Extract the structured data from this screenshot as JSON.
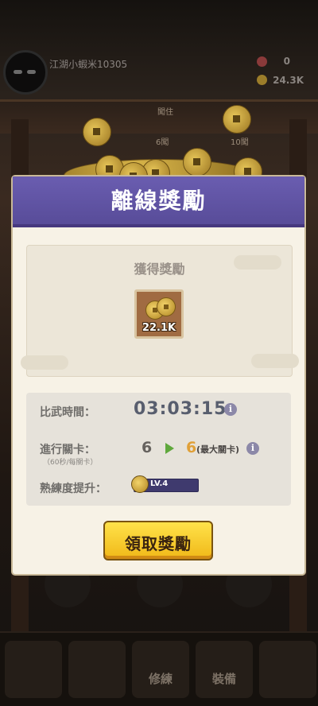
{
  "player": {
    "name": "江湖小蝦米10305",
    "gems": "0",
    "coins": "24.3K"
  },
  "background": {
    "stage_tags": [
      "闖住",
      "6闖",
      "10闖"
    ]
  },
  "bottom_nav": {
    "tabs": [
      "",
      "",
      "修練",
      "裝備",
      ""
    ]
  },
  "modal": {
    "title": "離線獎勵",
    "reward_section_title": "獲得獎勵",
    "reward_item": {
      "icon": "gold-coins-icon",
      "count": "22.1K"
    },
    "stats": {
      "battle_time_label": "比武時間：",
      "battle_time_value": "03:03:15",
      "progress_label": "進行關卡：",
      "progress_sub": "（60秒/每關卡）",
      "current_level": "6",
      "max_level": "6",
      "max_level_label": "(最大關卡)",
      "proficiency_label": "熟練度提升：",
      "proficiency_level": "LV.4",
      "proficiency_progress": 0
    },
    "claim_button_label": "領取獎勵"
  },
  "colors": {
    "header": "#5f52a5",
    "button": "#f7c52a",
    "timer": "#585e6e",
    "arrow": "#5fa83c"
  }
}
